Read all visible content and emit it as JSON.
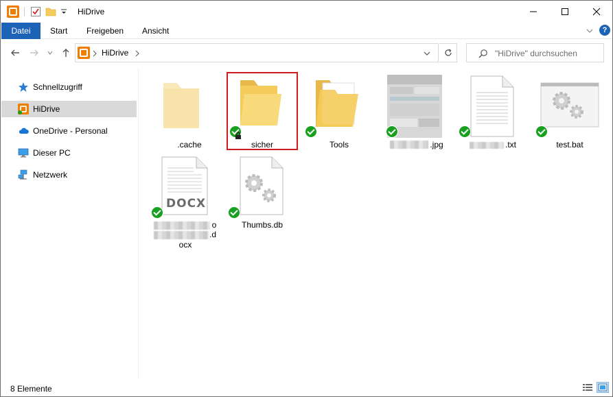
{
  "window": {
    "title": "HiDrive",
    "controls": {
      "minimize": "minimize-icon",
      "maximize": "maximize-icon",
      "close": "close-icon"
    }
  },
  "ribbon": {
    "tabs": [
      "Datei",
      "Start",
      "Freigeben",
      "Ansicht"
    ],
    "help_label": "?"
  },
  "address": {
    "location": "HiDrive",
    "search_placeholder": "\"HiDrive\" durchsuchen"
  },
  "sidebar": {
    "items": [
      {
        "label": "Schnellzugriff",
        "icon": "star-icon"
      },
      {
        "label": "HiDrive",
        "icon": "hidrive-icon",
        "active": true
      },
      {
        "label": "OneDrive - Personal",
        "icon": "cloud-icon"
      },
      {
        "label": "Dieser PC",
        "icon": "monitor-icon"
      },
      {
        "label": "Netzwerk",
        "icon": "network-icon"
      }
    ]
  },
  "files": [
    {
      "name": ".cache",
      "type": "folder",
      "synced": false
    },
    {
      "name": "sicher",
      "type": "folder",
      "synced": true,
      "locked": true,
      "selected": true
    },
    {
      "name": "Tools",
      "type": "folder",
      "synced": true
    },
    {
      "name": ".jpg",
      "type": "image",
      "synced": true
    },
    {
      "name": ".txt",
      "type": "text",
      "synced": true
    },
    {
      "name": "test.bat",
      "type": "bat",
      "synced": true
    },
    {
      "name_line1": "o",
      "name_line2": ".d",
      "name_line3": "ocx",
      "badge": "DOCX",
      "type": "docx",
      "synced": true
    },
    {
      "name": "Thumbs.db",
      "type": "db",
      "synced": true
    }
  ],
  "status": {
    "count": "8 Elemente"
  },
  "colors": {
    "accent": "#1c63b8",
    "sync_ok": "#1aa020",
    "selection_outline": "#d11a1a",
    "folder": "#f5cc5b"
  }
}
